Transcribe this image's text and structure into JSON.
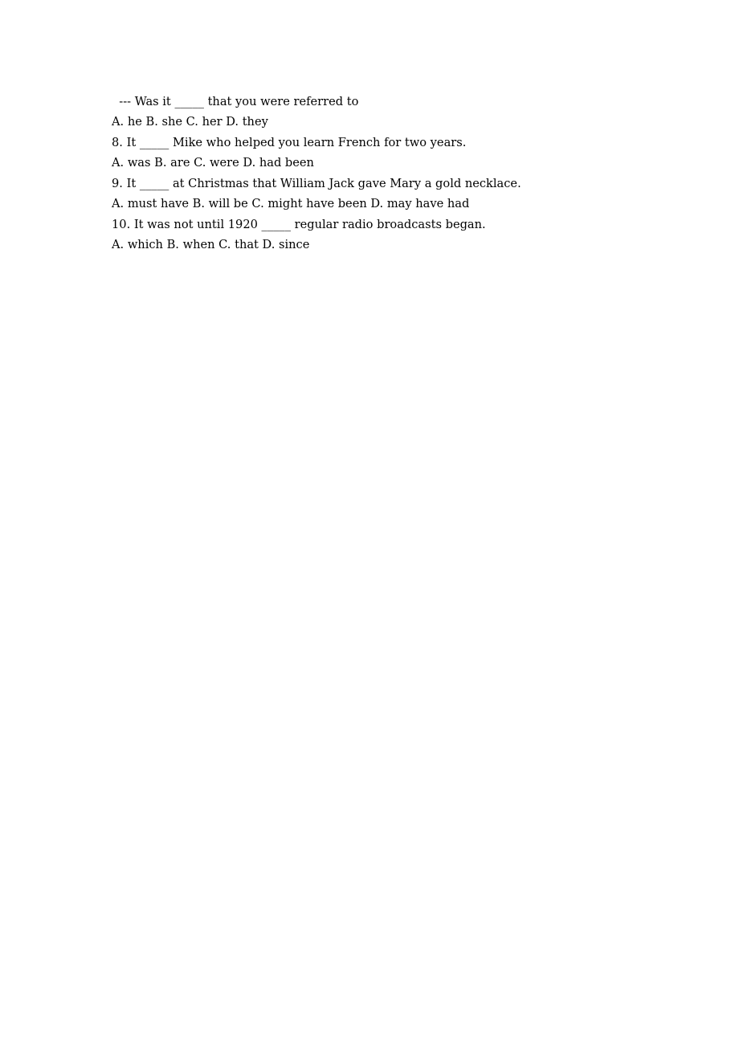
{
  "document": {
    "lines": [
      "  --- Was it _____ that you were referred to",
      "A. he B. she C. her D. they",
      "8. It _____ Mike who helped you learn French for two years.",
      "A. was B. are C. were D. had been",
      "9. It _____ at Christmas that William Jack gave Mary a gold necklace.",
      "A. must have B. will be C. might have been D. may have had",
      "10. It was not until 1920 _____ regular radio broadcasts began.",
      "A. which B. when C. that D. since"
    ]
  }
}
